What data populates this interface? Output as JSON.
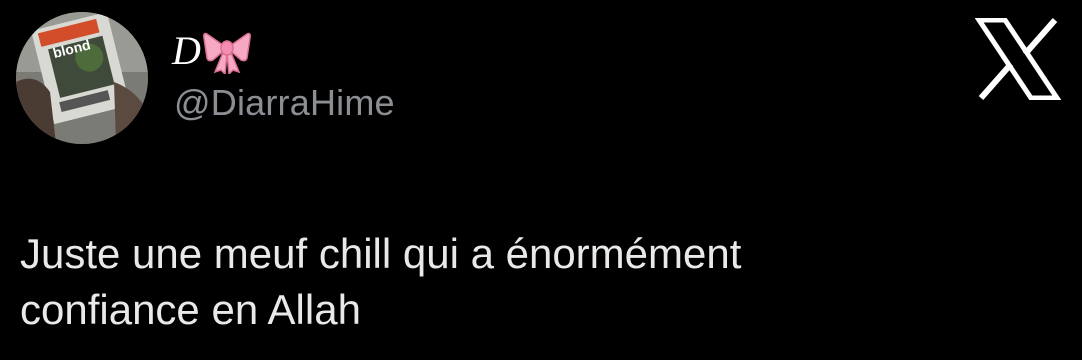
{
  "tweet": {
    "display_name": "D",
    "display_name_emoji": "bow-emoji",
    "handle": "@DiarraHime",
    "text": "Juste une meuf chill qui a énormément\nconfiance en Allah"
  },
  "avatar": {
    "album_text": "blond"
  },
  "icons": {
    "platform_logo": "x-logo-icon"
  },
  "colors": {
    "background": "#000000",
    "text": "#e7e9ea",
    "handle": "#8b8f94",
    "bow": "#f7a8c4"
  }
}
